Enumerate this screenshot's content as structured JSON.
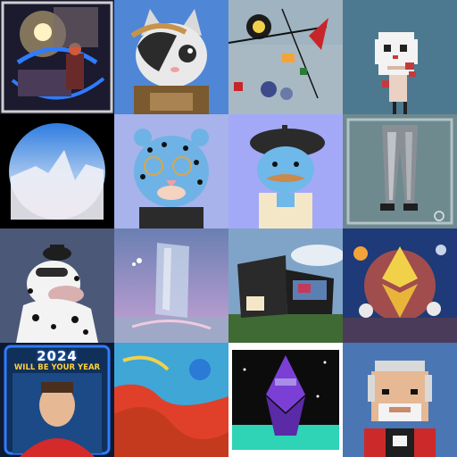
{
  "grid": {
    "tiles": [
      {
        "name": "tile-1",
        "kind": "dreamscape artwork"
      },
      {
        "name": "tile-2",
        "kind": "astronaut cat"
      },
      {
        "name": "tile-3",
        "kind": "abstract shapes"
      },
      {
        "name": "tile-4",
        "kind": "pixel skull"
      },
      {
        "name": "tile-5",
        "kind": "circle gradient"
      },
      {
        "name": "tile-6",
        "kind": "blue leopard"
      },
      {
        "name": "tile-7",
        "kind": "beret character"
      },
      {
        "name": "tile-8",
        "kind": "silver trousers"
      },
      {
        "name": "tile-9",
        "kind": "dalmatian"
      },
      {
        "name": "tile-10",
        "kind": "crystal block"
      },
      {
        "name": "tile-11",
        "kind": "architecture render"
      },
      {
        "name": "tile-12",
        "kind": "ethereum space painting"
      },
      {
        "name": "tile-13",
        "kind": "2024 poster",
        "title": "2024",
        "subtitle": "WILL BE YOUR YEAR"
      },
      {
        "name": "tile-14",
        "kind": "red blue texture"
      },
      {
        "name": "tile-15",
        "kind": "purple rocket"
      },
      {
        "name": "tile-16",
        "kind": "pixel old man"
      }
    ]
  },
  "colors": {
    "accent": "#2f7cff",
    "cat_bg": "#4f86d6",
    "leopard_bg": "#a7b3ea",
    "beret_bg": "#a3a9f7",
    "old_man_bg": "#4a76b4"
  }
}
